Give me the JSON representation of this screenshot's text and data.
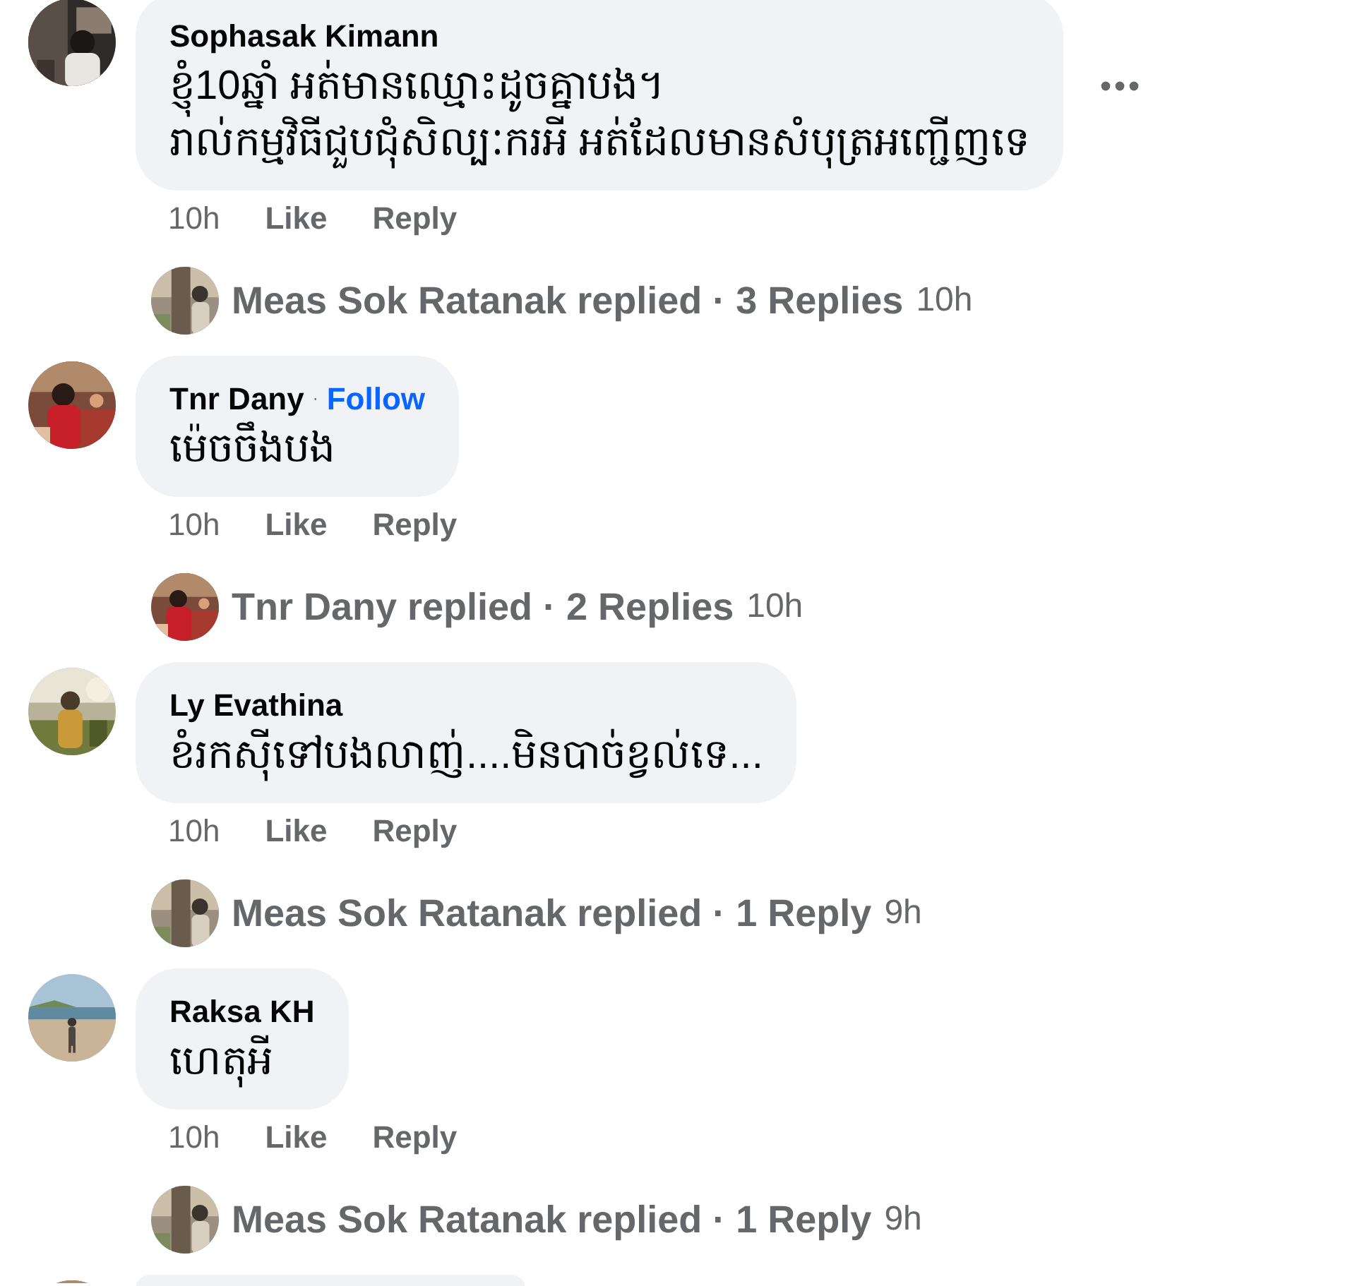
{
  "comments": [
    {
      "author": "Sophasak Kimann",
      "lines": [
        "ខ្ញុំ10ឆ្នាំ អត់មានឈ្មោះដូចគ្នាបង។",
        "រាល់កម្មវិធីជួបជុំសិល្បៈករអី អត់ដែលមានសំបុត្រអញ្ជើញទេ"
      ],
      "more_menu": true,
      "time": "10h",
      "like": "Like",
      "reply": "Reply",
      "replies": {
        "summary": "Meas Sok Ratanak replied · 3 Replies",
        "time": "10h"
      }
    },
    {
      "author": "Tnr Dany",
      "follow_separator": "·",
      "follow": "Follow",
      "lines": [
        "ម៉េចចឹងបង"
      ],
      "more_menu": false,
      "time": "10h",
      "like": "Like",
      "reply": "Reply",
      "replies": {
        "summary": "Tnr Dany replied · 2 Replies",
        "time": "10h"
      }
    },
    {
      "author": "Ly Evathina",
      "lines": [
        "ខំរកស៊ីទៅបងលាញ់....មិនបាច់ខ្វល់ទេ..."
      ],
      "more_menu": false,
      "time": "10h",
      "like": "Like",
      "reply": "Reply",
      "replies": {
        "summary": "Meas Sok Ratanak replied · 1 Reply",
        "time": "9h"
      }
    },
    {
      "author": "Raksa KH",
      "lines": [
        "ហេតុអី"
      ],
      "more_menu": false,
      "time": "10h",
      "like": "Like",
      "reply": "Reply",
      "replies": {
        "summary": "Meas Sok Ratanak replied · 1 Reply",
        "time": "9h"
      }
    }
  ],
  "next_comment_partial": true
}
